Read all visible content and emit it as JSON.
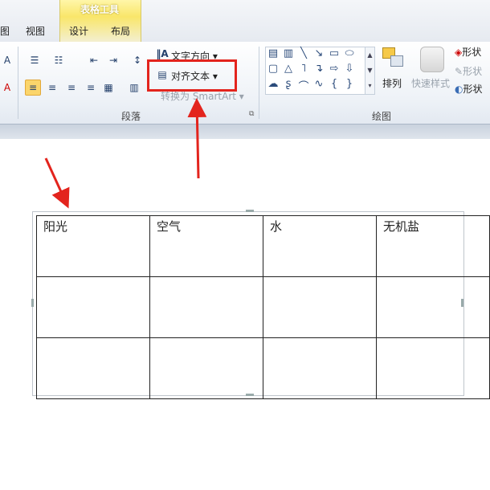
{
  "tabs": {
    "context_title": "表格工具",
    "partial": "图",
    "view": "视图",
    "design": "设计",
    "layout": "布局"
  },
  "ribbon": {
    "text_direction": "文字方向",
    "align_text": "对齐文本",
    "convert_smartart": "转换为 SmartArt",
    "paragraph_group": "段落",
    "drawing_group": "绘图",
    "arrange": "排列",
    "quick_styles": "快速样式",
    "shape_fill": "形状",
    "shape_outline": "形状",
    "shape_effects": "形状"
  },
  "table": {
    "rows": [
      [
        "阳光",
        "空气",
        "水",
        "无机盐"
      ],
      [
        "",
        "",
        "",
        ""
      ],
      [
        "",
        "",
        "",
        ""
      ]
    ]
  },
  "annotation_color": "#e3241d",
  "accent": "#fbd56b"
}
